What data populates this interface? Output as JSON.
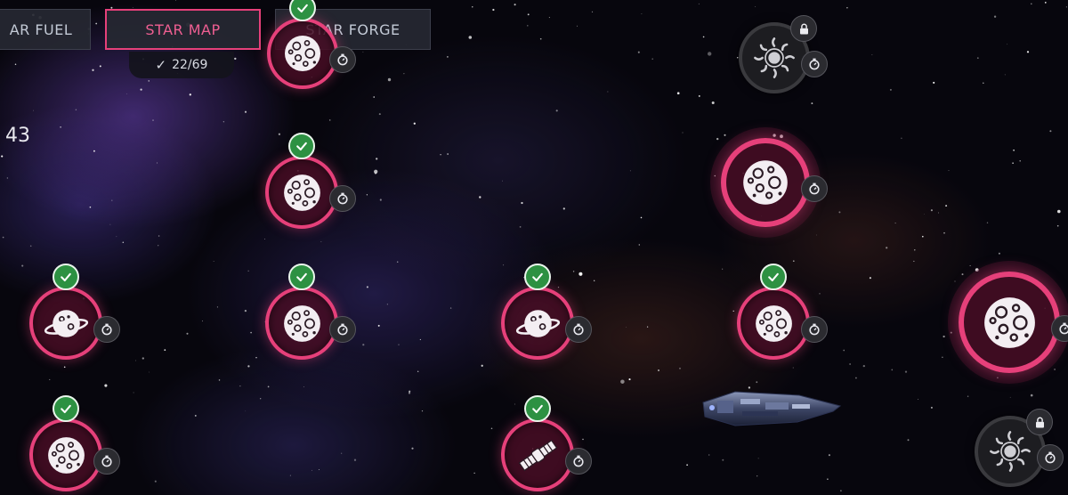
{
  "tabs": [
    {
      "label": "AR FUEL",
      "active": false
    },
    {
      "label": "STAR MAP",
      "active": true
    },
    {
      "label": "STAR FORGE",
      "active": false
    }
  ],
  "progress": {
    "completed": 22,
    "total": 69,
    "label": "22/69"
  },
  "side_value": "43",
  "colors": {
    "accent": "#e6407a",
    "complete": "#2d9142",
    "locked": "#3a3a3e"
  },
  "nodes": [
    {
      "id": "node-top-asteroid",
      "icon": "asteroid-icon",
      "status": "completed"
    },
    {
      "id": "node-top-sun",
      "icon": "sun-icon",
      "status": "locked"
    },
    {
      "id": "node-row2-asteroid",
      "icon": "asteroid-icon",
      "status": "completed"
    },
    {
      "id": "node-row2-big-asteroid",
      "icon": "asteroid-icon",
      "status": "available"
    },
    {
      "id": "node-row3-ringed-planet-1",
      "icon": "ringed-planet-icon",
      "status": "completed"
    },
    {
      "id": "node-row3-asteroid-1",
      "icon": "asteroid-icon",
      "status": "completed"
    },
    {
      "id": "node-row3-ringed-planet-2",
      "icon": "ringed-planet-icon",
      "status": "completed"
    },
    {
      "id": "node-row3-asteroid-2",
      "icon": "asteroid-icon",
      "status": "completed"
    },
    {
      "id": "node-row3-big-asteroid",
      "icon": "asteroid-icon",
      "status": "available"
    },
    {
      "id": "node-row4-asteroid",
      "icon": "asteroid-icon",
      "status": "completed"
    },
    {
      "id": "node-row4-satellite",
      "icon": "satellite-icon",
      "status": "completed"
    },
    {
      "id": "node-row4-sun",
      "icon": "sun-icon",
      "status": "locked"
    }
  ]
}
